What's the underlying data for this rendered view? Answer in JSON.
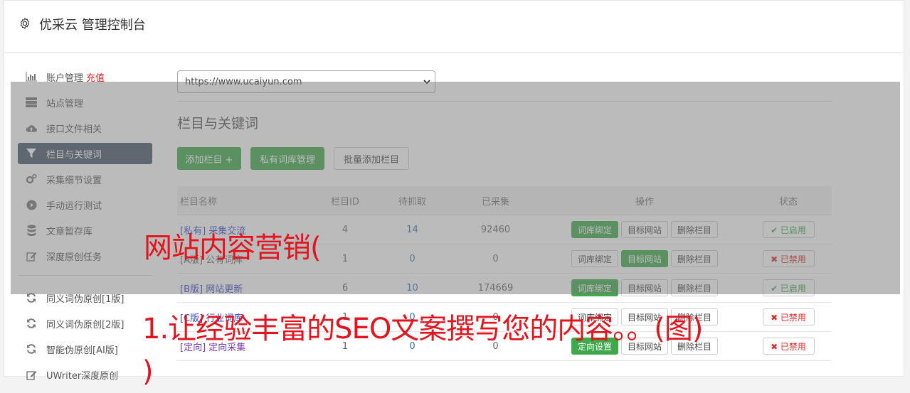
{
  "header": {
    "title": "优采云 管理控制台",
    "icon": "gear-icon"
  },
  "sidebar": {
    "items": [
      {
        "label": "账户管理",
        "extra": "充值",
        "icon": "bar-chart-icon"
      },
      {
        "label": "站点管理",
        "icon": "server-icon"
      },
      {
        "label": "接口文件相关",
        "icon": "cloud-upload-icon"
      },
      {
        "label": "栏目与关键词",
        "icon": "filter-icon",
        "active": true
      },
      {
        "label": "采集细节设置",
        "icon": "gears-icon"
      },
      {
        "label": "手动运行测试",
        "icon": "play-circle-icon"
      },
      {
        "label": "文章暂存库",
        "icon": "database-icon"
      },
      {
        "label": "深度原创任务",
        "icon": "edit-icon"
      }
    ],
    "items2": [
      {
        "label": "同义词伪原创[1版]",
        "icon": "refresh-icon"
      },
      {
        "label": "同义词伪原创[2版]",
        "icon": "refresh-icon"
      },
      {
        "label": "智能伪原创[AI版]",
        "icon": "refresh-icon"
      },
      {
        "label": "UWriter深度原创",
        "icon": "edit-icon"
      }
    ]
  },
  "main": {
    "site_select": "https://www.ucaiyun.com",
    "section_title": "栏目与关键词",
    "buttons": {
      "add": "添加栏目 +",
      "private": "私有词库管理",
      "batch": "批量添加栏目"
    },
    "table": {
      "headers": [
        "栏目名称",
        "栏目ID",
        "待抓取",
        "已采集",
        "操作",
        "状态"
      ],
      "rows": [
        {
          "tag": "[私有]",
          "name": "采集交流",
          "id": "4",
          "pending": "14",
          "collected": "92460",
          "op1": "词库绑定",
          "op2": "目标网站",
          "op3": "删除栏目",
          "status": "✔ 已启用"
        },
        {
          "tag": "[A版]",
          "name": "公有词库",
          "id": "1",
          "pending": "0",
          "collected": "0",
          "op1": "词库绑定",
          "op2": "目标网站",
          "op3": "删除栏目",
          "status": "✖ 已禁用"
        },
        {
          "tag": "[B版]",
          "name": "网站更新",
          "id": "6",
          "pending": "10",
          "collected": "174669",
          "op1": "词库绑定",
          "op2": "目标网站",
          "op3": "删除栏目",
          "status": "✔ 已启用"
        },
        {
          "tag": "[C版]",
          "name": "行业词库",
          "id": "1",
          "pending": "0",
          "collected": "0",
          "op1": "词库绑定",
          "op2": "目标网站",
          "op3": "删除栏目",
          "status": "✖ 已禁用"
        },
        {
          "tag": "[定向]",
          "name": "定向采集",
          "id": "1",
          "pending": "0",
          "collected": "0",
          "op1": "定向设置",
          "op2": "目标网站",
          "op3": "删除栏目",
          "status": "✖ 已禁用"
        }
      ]
    }
  },
  "overlay_text": {
    "line1": "网站内容营销(",
    "line2": "1.让经验丰富的SEO文案撰写您的内容。。(图)",
    "line3": ")"
  },
  "colors": {
    "green": "#3ea94b",
    "active_nav": "#475668",
    "red": "#e3141e"
  }
}
